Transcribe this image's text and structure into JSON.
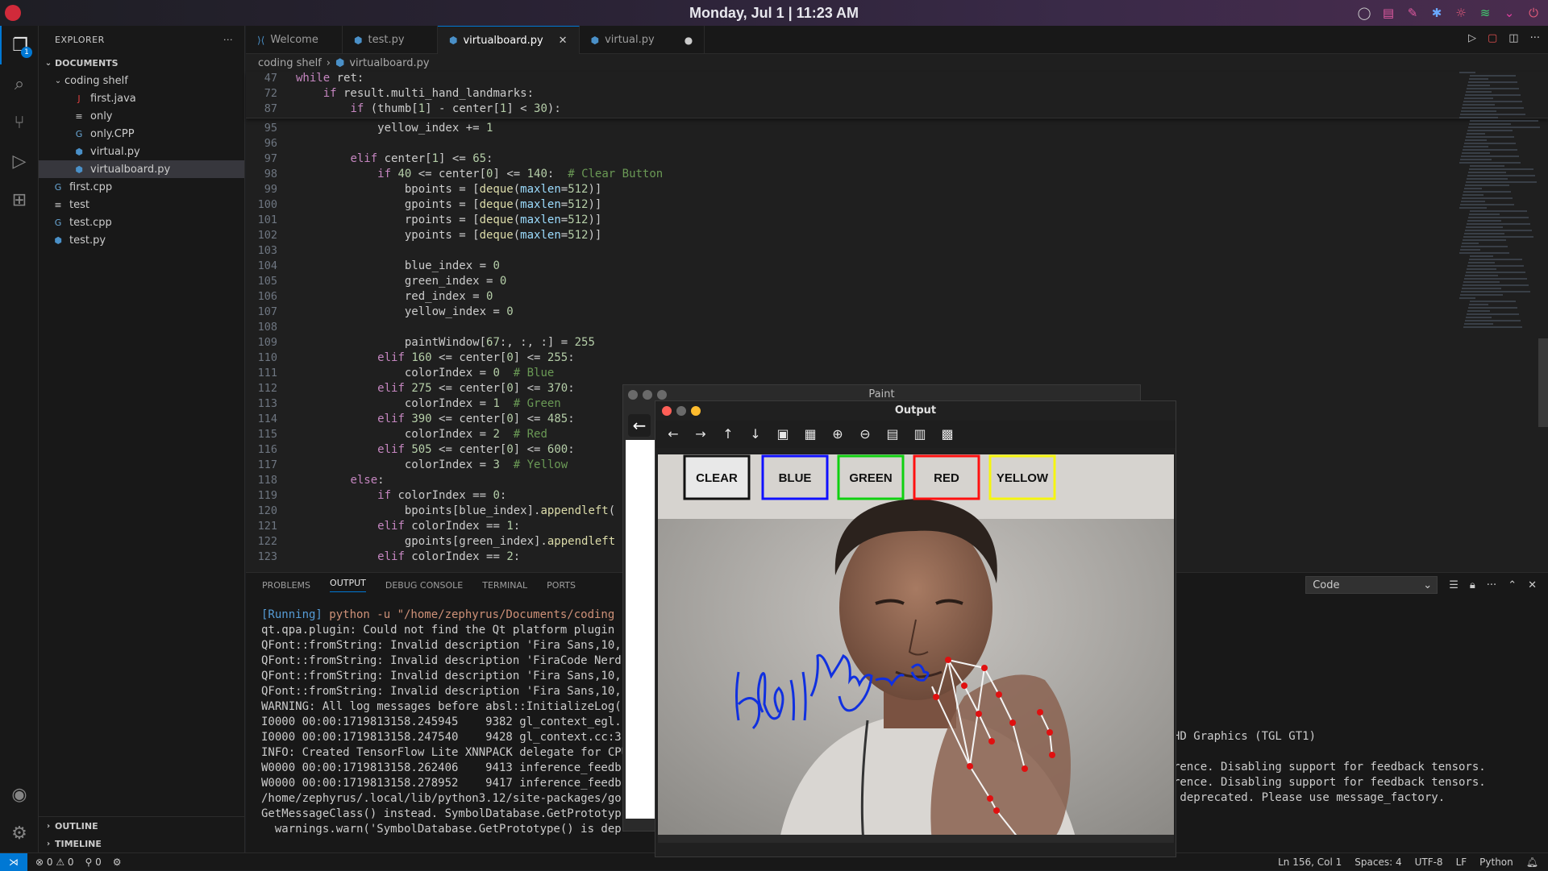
{
  "topbar": {
    "clock": "Monday, Jul 1 | 11:23 AM"
  },
  "sidebar": {
    "title": "EXPLORER",
    "more": "···",
    "section": "DOCUMENTS",
    "folder": "coding shelf",
    "items": [
      {
        "name": "first.java",
        "icon": "J",
        "color": "#e04040"
      },
      {
        "name": "only",
        "icon": "≡",
        "color": "#cccccc"
      },
      {
        "name": "only.CPP",
        "icon": "G",
        "color": "#6aa9d8"
      },
      {
        "name": "virtual.py",
        "icon": "⬢",
        "color": "#4a90c8"
      },
      {
        "name": "virtualboard.py",
        "icon": "⬢",
        "color": "#4a90c8"
      },
      {
        "name": "first.cpp",
        "icon": "G",
        "color": "#6aa9d8"
      },
      {
        "name": "test",
        "icon": "≡",
        "color": "#cccccc"
      },
      {
        "name": "test.cpp",
        "icon": "G",
        "color": "#6aa9d8"
      },
      {
        "name": "test.py",
        "icon": "⬢",
        "color": "#4a90c8"
      }
    ],
    "outline": "OUTLINE",
    "timeline": "TIMELINE"
  },
  "tabs": [
    {
      "label": "Welcome"
    },
    {
      "label": "test.py"
    },
    {
      "label": "virtualboard.py"
    },
    {
      "label": "virtual.py"
    }
  ],
  "breadcrumb": {
    "folder": "coding shelf",
    "file": "virtualboard.py"
  },
  "sticky_lines": [
    {
      "n": "47",
      "html": "<span class=\"kw\">while</span> ret:"
    },
    {
      "n": "72",
      "html": "    <span class=\"kw\">if</span> result.multi_hand_landmarks:"
    },
    {
      "n": "87",
      "html": "        <span class=\"kw\">if</span> (thumb[<span class=\"num\">1</span>] - center[<span class=\"num\">1</span>] &lt; <span class=\"num\">30</span>):"
    }
  ],
  "code_lines": [
    {
      "n": "95",
      "html": "            yellow_index += <span class=\"num\">1</span>"
    },
    {
      "n": "96",
      "html": ""
    },
    {
      "n": "97",
      "html": "        <span class=\"kw\">elif</span> center[<span class=\"num\">1</span>] &lt;= <span class=\"num\">65</span>:"
    },
    {
      "n": "98",
      "html": "            <span class=\"kw\">if</span> <span class=\"num\">40</span> &lt;= center[<span class=\"num\">0</span>] &lt;= <span class=\"num\">140</span>:  <span class=\"cm\"># Clear Button</span>"
    },
    {
      "n": "99",
      "html": "                bpoints = [<span class=\"fn\">deque</span>(<span class=\"var\">maxlen</span>=<span class=\"num\">512</span>)]"
    },
    {
      "n": "100",
      "html": "                gpoints = [<span class=\"fn\">deque</span>(<span class=\"var\">maxlen</span>=<span class=\"num\">512</span>)]"
    },
    {
      "n": "101",
      "html": "                rpoints = [<span class=\"fn\">deque</span>(<span class=\"var\">maxlen</span>=<span class=\"num\">512</span>)]"
    },
    {
      "n": "102",
      "html": "                ypoints = [<span class=\"fn\">deque</span>(<span class=\"var\">maxlen</span>=<span class=\"num\">512</span>)]"
    },
    {
      "n": "103",
      "html": ""
    },
    {
      "n": "104",
      "html": "                blue_index = <span class=\"num\">0</span>"
    },
    {
      "n": "105",
      "html": "                green_index = <span class=\"num\">0</span>"
    },
    {
      "n": "106",
      "html": "                red_index = <span class=\"num\">0</span>"
    },
    {
      "n": "107",
      "html": "                yellow_index = <span class=\"num\">0</span>"
    },
    {
      "n": "108",
      "html": ""
    },
    {
      "n": "109",
      "html": "                paintWindow[<span class=\"num\">67</span>:, :, :] = <span class=\"num\">255</span>"
    },
    {
      "n": "110",
      "html": "            <span class=\"kw\">elif</span> <span class=\"num\">160</span> &lt;= center[<span class=\"num\">0</span>] &lt;= <span class=\"num\">255</span>:"
    },
    {
      "n": "111",
      "html": "                colorIndex = <span class=\"num\">0</span>  <span class=\"cm\"># Blue</span>"
    },
    {
      "n": "112",
      "html": "            <span class=\"kw\">elif</span> <span class=\"num\">275</span> &lt;= center[<span class=\"num\">0</span>] &lt;= <span class=\"num\">370</span>:"
    },
    {
      "n": "113",
      "html": "                colorIndex = <span class=\"num\">1</span>  <span class=\"cm\"># Green</span>"
    },
    {
      "n": "114",
      "html": "            <span class=\"kw\">elif</span> <span class=\"num\">390</span> &lt;= center[<span class=\"num\">0</span>] &lt;= <span class=\"num\">485</span>:"
    },
    {
      "n": "115",
      "html": "                colorIndex = <span class=\"num\">2</span>  <span class=\"cm\"># Red</span>"
    },
    {
      "n": "116",
      "html": "            <span class=\"kw\">elif</span> <span class=\"num\">505</span> &lt;= center[<span class=\"num\">0</span>] &lt;= <span class=\"num\">600</span>:"
    },
    {
      "n": "117",
      "html": "                colorIndex = <span class=\"num\">3</span>  <span class=\"cm\"># Yellow</span>"
    },
    {
      "n": "118",
      "html": "        <span class=\"kw\">else</span>:"
    },
    {
      "n": "119",
      "html": "            <span class=\"kw\">if</span> colorIndex == <span class=\"num\">0</span>:"
    },
    {
      "n": "120",
      "html": "                bpoints[blue_index].<span class=\"fn\">appendleft</span>("
    },
    {
      "n": "121",
      "html": "            <span class=\"kw\">elif</span> colorIndex == <span class=\"num\">1</span>:"
    },
    {
      "n": "122",
      "html": "                gpoints[green_index].<span class=\"fn\">appendleft</span>"
    },
    {
      "n": "123",
      "html": "            <span class=\"kw\">elif</span> colorIndex == <span class=\"num\">2</span>:"
    }
  ],
  "panel": {
    "tabs": [
      "PROBLEMS",
      "OUTPUT",
      "DEBUG CONSOLE",
      "TERMINAL",
      "PORTS"
    ],
    "active_tab": "OUTPUT",
    "channel": "Code",
    "running": "[Running]",
    "command": " python -u \"/home/zephyrus/Documents/coding",
    "lines": [
      "qt.qpa.plugin: Could not find the Qt platform plugin",
      "QFont::fromString: Invalid description 'Fira Sans,10,",
      "QFont::fromString: Invalid description 'FiraCode Nerd",
      "QFont::fromString: Invalid description 'Fira Sans,10,",
      "QFont::fromString: Invalid description 'Fira Sans,10,",
      "WARNING: All log messages before absl::InitializeLog(",
      "I0000 00:00:1719813158.245945    9382 gl_context_egl.",
      "I0000 00:00:1719813158.247540    9428 gl_context.cc:3",
      "INFO: Created TensorFlow Lite XNNPACK delegate for CPU",
      "W0000 00:00:1719813158.262406    9413 inference_feedb",
      "W0000 00:00:1719813158.278952    9417 inference_feedb",
      "/home/zephyrus/.local/lib/python3.12/site-packages/go",
      "GetMessageClass() instead. SymbolDatabase.GetPrototyp",
      "  warnings.warn('SymbolDatabase.GetPrototype() is dep"
    ],
    "right_lines": [
      "HD Graphics (TGL GT1)",
      "",
      "rence. Disabling support for feedback tensors.",
      "rence. Disabling support for feedback tensors.",
      " deprecated. Please use message_factory."
    ]
  },
  "status": {
    "errors": "⊗ 0 ⚠ 0",
    "ports": "⚲ 0",
    "position": "Ln 156, Col 1",
    "spaces": "Spaces: 4",
    "encoding": "UTF-8",
    "eol": "LF",
    "language": "Python"
  },
  "paint": {
    "title": "Paint"
  },
  "output_window": {
    "title": "Output",
    "buttons": [
      {
        "label": "CLEAR",
        "color": "#111111",
        "fill": "#e8e8e8"
      },
      {
        "label": "BLUE",
        "color": "#1010ff",
        "fill": "none"
      },
      {
        "label": "GREEN",
        "color": "#10d010",
        "fill": "none"
      },
      {
        "label": "RED",
        "color": "#ff1010",
        "fill": "none"
      },
      {
        "label": "YELLOW",
        "color": "#f5f510",
        "fill": "none"
      }
    ]
  }
}
